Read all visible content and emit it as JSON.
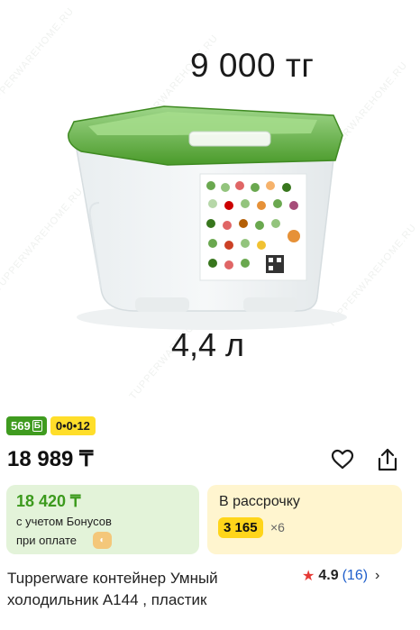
{
  "image_overlay": {
    "price_text": "9 000 тг",
    "volume_text": "4,4 л",
    "watermark_text": "TUPPERWAREHOME.RU"
  },
  "badges": {
    "bonus": "569",
    "bonus_icon": "bonus-b-icon",
    "installment": "0•0•12"
  },
  "price": {
    "main": "18 989 ₸"
  },
  "actions": {
    "favorite_icon": "heart-icon",
    "share_icon": "share-icon"
  },
  "bonus_card": {
    "price": "18 420 ₸",
    "line1": "с учетом Бонусов",
    "line2": "при оплате",
    "coin_icon": "bonus-coin-icon"
  },
  "installment_card": {
    "label": "В рассрочку",
    "amount": "3 165",
    "multiplier": "×6"
  },
  "product": {
    "title": "Tupperware контейнер Умный холодильник А144 , пластик"
  },
  "rating": {
    "score": "4.9",
    "count": "(16)"
  },
  "colors": {
    "bonus_green": "#3f9b1f",
    "yellow": "#ffd51a",
    "lid_green": "#4a9a2a",
    "star_red": "#e53935",
    "link_blue": "#1f5fcc"
  }
}
